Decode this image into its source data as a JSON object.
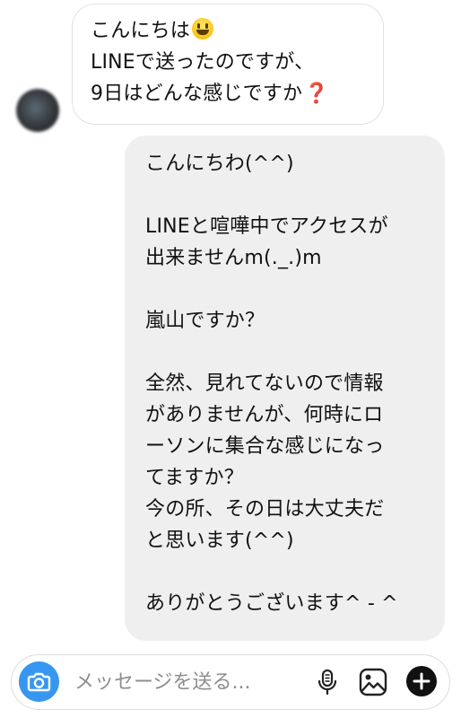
{
  "incoming_message": {
    "lines": [
      "こんにちは",
      "LINEで送ったのですが、",
      "9日はどんな感じですか"
    ],
    "emoji_1": "smiling-face",
    "emoji_2": "red-question-mark"
  },
  "outgoing_message": {
    "lines": [
      "こんにちわ(^^)",
      "",
      "LINEと喧嘩中でアクセスが",
      "出来ませんm(._.)m",
      "",
      "嵐山ですか？",
      "",
      "全然、見れてないので情報",
      "がありませんが、何時にロ",
      "ーソンに集合な感じになっ",
      "てますか？",
      "今の所、その日は大丈夫だ",
      "と思います(^^)",
      "",
      "ありがとうございます^ - ^"
    ]
  },
  "composer": {
    "placeholder": "メッセージを送る...",
    "icons": [
      "camera-icon",
      "microphone-icon",
      "gallery-icon",
      "plus-icon"
    ],
    "accent_color": "#3797f0"
  }
}
